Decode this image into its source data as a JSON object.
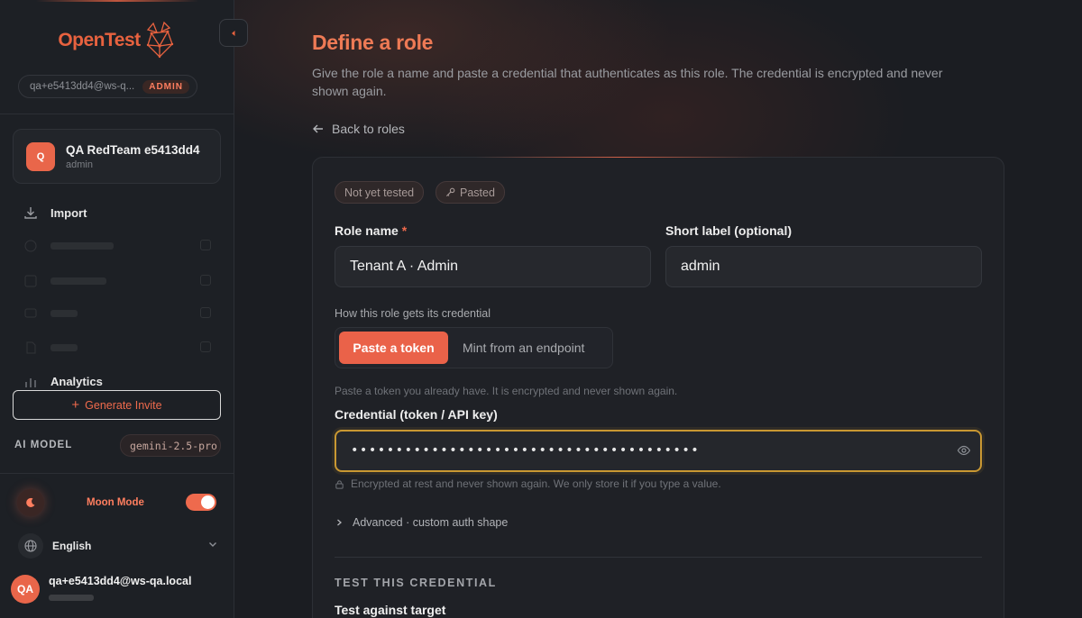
{
  "sidebar": {
    "logo_text": "OpenTest",
    "account_email": "qa+e5413dd4@ws-q...",
    "admin_badge": "ADMIN",
    "workspace": {
      "initial": "Q",
      "name": "QA RedTeam e5413dd4",
      "role": "admin"
    },
    "nav": {
      "import": "Import",
      "analytics": "Analytics"
    },
    "generate_invite": "Generate Invite",
    "ai_model_label": "AI MODEL",
    "ai_model_value": "gemini-2.5-pro",
    "moon_mode": "Moon Mode",
    "language": "English",
    "user": {
      "initials": "QA",
      "email": "qa+e5413dd4@ws-qa.local"
    }
  },
  "main": {
    "title": "Define a role",
    "subtitle": "Give the role a name and paste a credential that authenticates as this role. The credential is encrypted and never shown again.",
    "back": "Back to roles",
    "chips": {
      "status": "Not yet tested",
      "source": "Pasted"
    },
    "role_name_label": "Role name",
    "required_mark": "*",
    "role_name_value": "Tenant A · Admin",
    "short_label_label": "Short label (optional)",
    "short_label_value": "admin",
    "credential_method_label": "How this role gets its credential",
    "method_paste": "Paste a token",
    "method_mint": "Mint from an endpoint",
    "paste_hint": "Paste a token you already have. It is encrypted and never shown again.",
    "credential_label": "Credential (token / API key)",
    "credential_masked": "•••••••••••••••••••••••••••••••••••••••",
    "encrypted_note": "Encrypted at rest and never shown again. We only store it if you type a value.",
    "advanced": "Advanced · custom auth shape",
    "test_section": "TEST THIS CREDENTIAL",
    "test_target": "Test against target"
  },
  "colors": {
    "accent": "#ea6249",
    "focus_border": "#c99832",
    "background": "#1b1d22"
  }
}
